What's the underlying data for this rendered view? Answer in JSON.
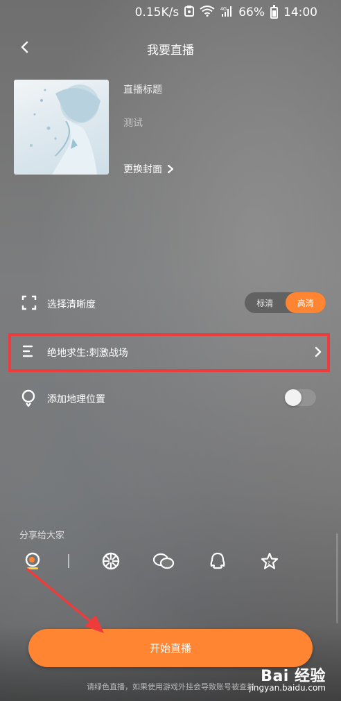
{
  "status_bar": {
    "network_speed": "0.15K/s",
    "signal_label": "4G",
    "battery": "66%",
    "time": "14:00"
  },
  "header": {
    "title": "我要直播",
    "back_icon": "chevron-left-icon"
  },
  "cover": {
    "title_label": "直播标题",
    "title_value": "测试",
    "change_cover_label": "更换封面"
  },
  "quality": {
    "label": "选择清晰度",
    "options": [
      "标清",
      "高清"
    ],
    "selected": "高清"
  },
  "game": {
    "label": "绝地求生:刺激战场",
    "highlight_color": "#ee3b3b"
  },
  "location": {
    "label": "添加地理位置",
    "enabled": false
  },
  "share": {
    "label": "分享给大家",
    "icons": [
      "qq-zone-icon",
      "moments-icon",
      "wechat-icon",
      "qq-icon",
      "favorite-star-icon"
    ]
  },
  "start_button": {
    "label": "开始直播",
    "color": "#ff8533"
  },
  "notice": {
    "text": "请绿色直播，如果使用游戏外挂会导致账号被查封"
  },
  "watermark": {
    "brand": "Bai 经验",
    "url": "jingyan.baidu.com"
  },
  "colors": {
    "accent": "#ff8533",
    "annotation": "#ee3b3b"
  }
}
